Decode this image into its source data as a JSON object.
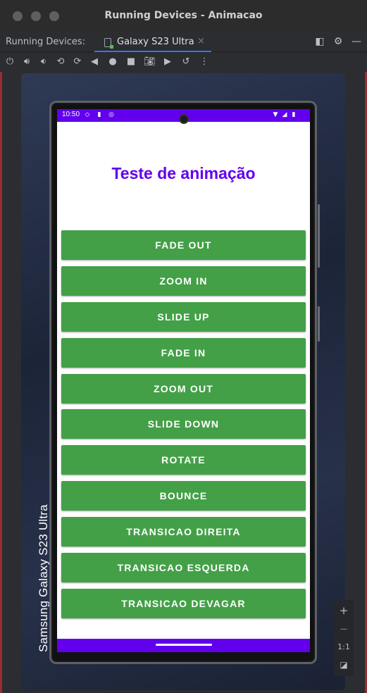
{
  "window": {
    "title": "Running Devices - Animacao"
  },
  "tool_window": {
    "label": "Running Devices:",
    "tab_label": "Galaxy S23 Ultra",
    "tab_close": "×"
  },
  "toolbar": {
    "icons": [
      "power-icon",
      "volume-up-icon",
      "volume-down-icon",
      "rotate-left-icon",
      "rotate-right-icon",
      "back-icon",
      "home-icon",
      "overview-icon",
      "screenshot-icon",
      "screen-record-icon",
      "reset-icon",
      "more-icon"
    ]
  },
  "device": {
    "label": "Samsung Galaxy  S23 Ultra"
  },
  "status_bar": {
    "time": "10:50"
  },
  "app": {
    "heading": "Teste de animação",
    "buttons": [
      "FADE OUT",
      "ZOOM IN",
      "SLIDE UP",
      "FADE IN",
      "ZOOM OUT",
      "SLIDE DOWN",
      "ROTATE",
      "BOUNCE",
      "TRANSICAO DIREITA",
      "TRANSICAO ESQUERDA",
      "TRANSICAO DEVAGAR"
    ]
  },
  "zoom": {
    "in": "+",
    "out": "−",
    "actual": "1:1"
  },
  "colors": {
    "primary": "#6200ee",
    "button": "#43a047",
    "heading": "#6200ee"
  }
}
